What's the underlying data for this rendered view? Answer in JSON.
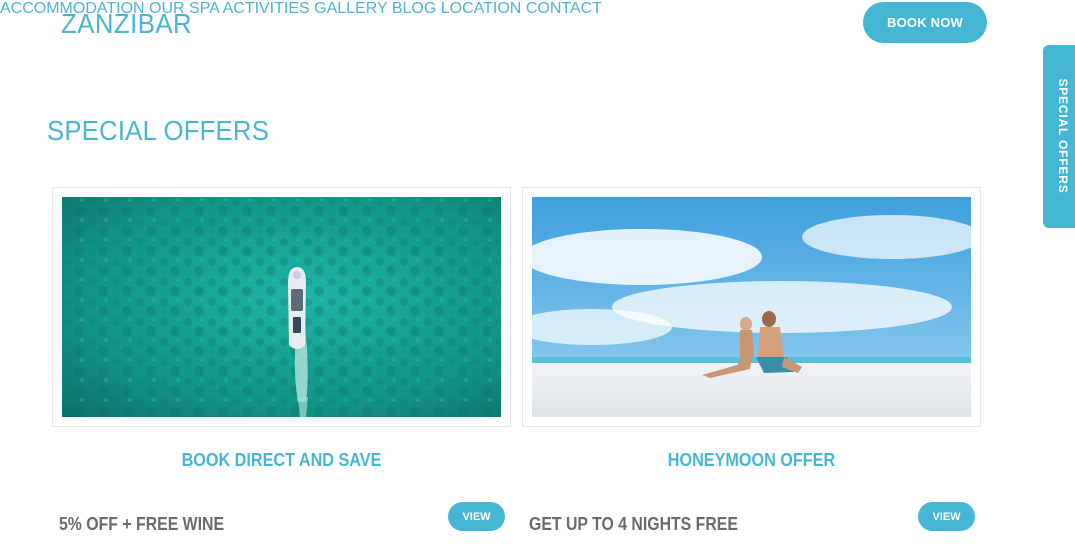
{
  "header": {
    "logo": "ZANZIBAR",
    "nav": [
      {
        "label": "ACCOMMODATION"
      },
      {
        "label": "OUR SPA"
      },
      {
        "label": "ACTIVITIES"
      },
      {
        "label": "GALLERY"
      },
      {
        "label": "BLOG"
      },
      {
        "label": "LOCATION"
      },
      {
        "label": "CONTACT"
      }
    ],
    "book_now": "BOOK NOW"
  },
  "side_tab": "SPECIAL OFFERS",
  "main": {
    "title": "SPECIAL OFFERS",
    "offers": [
      {
        "title": "BOOK DIRECT AND SAVE",
        "subtitle": "5%  OFF + FREE WINE",
        "button": "VIEW",
        "image": "aerial-boat-turquoise-sea"
      },
      {
        "title": "HONEYMOON OFFER",
        "subtitle": "GET UP TO 4 NIGHTS FREE",
        "button": "VIEW",
        "image": "couple-on-white-beach"
      }
    ]
  },
  "colors": {
    "accent": "#45b6d3",
    "nav_text": "#5aa3b8",
    "body_text": "#6b6b6b"
  }
}
